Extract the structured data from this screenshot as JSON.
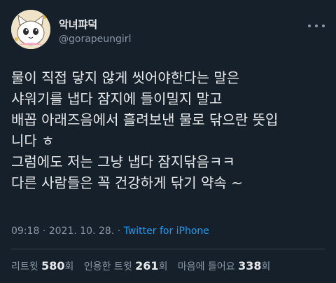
{
  "user": {
    "display_name": "악녀퍄덕",
    "handle": "@gorapeungirl",
    "avatar_icon": "cartoon-cat-avatar-icon"
  },
  "tweet": {
    "lines": [
      "물이 직접 닿지 않게 씻어야한다는 말은",
      "샤워기를 냅다 잠지에 들이밀지 말고",
      "배꼽 아래즈음에서 흘려보낸 물로 닦으란 뜻입",
      "니다 ㅎ",
      "그럼에도 저는 그냥 냅다 잠지닦음ㅋㅋ",
      "다른 사람들은 꼭 건강하게 닦기 약속 ~"
    ]
  },
  "meta": {
    "time": "09:18",
    "dot1": "·",
    "date": "2021. 10. 28.",
    "dot2": "·",
    "source": "Twitter for iPhone"
  },
  "stats": {
    "retweets_label": "리트윗",
    "retweets_count": "580",
    "retweets_unit": "회",
    "quotes_label": "인용한 트윗",
    "quotes_count": "261",
    "quotes_unit": "회",
    "likes_label": "마음에 들어요",
    "likes_count": "338",
    "likes_unit": "회"
  },
  "colors": {
    "background": "#15202b",
    "text": "#e7e9ea",
    "muted": "#8b98a5",
    "link": "#1d9bf0"
  }
}
